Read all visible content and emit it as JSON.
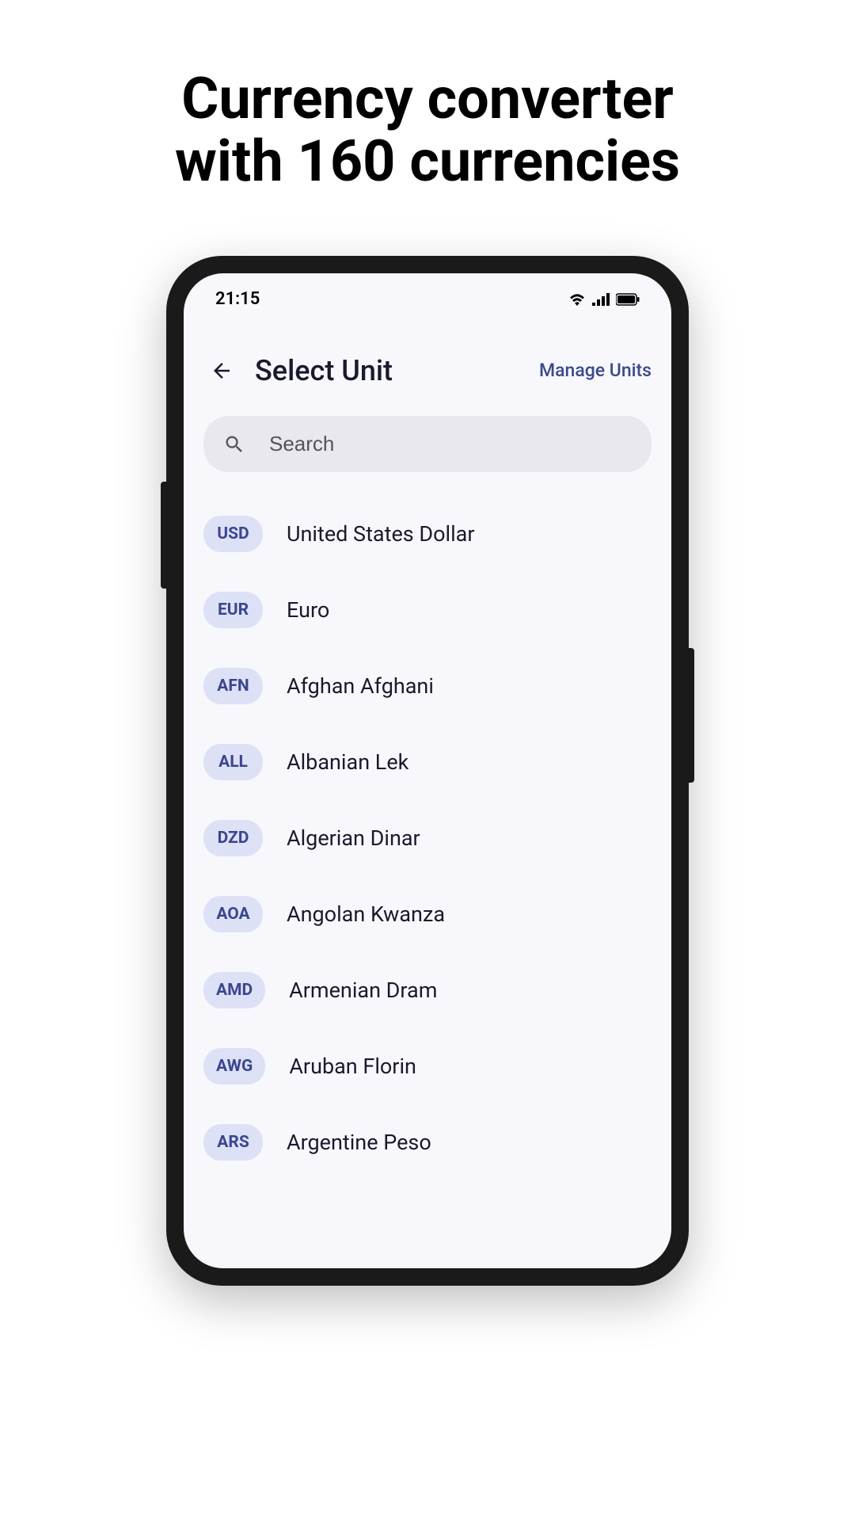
{
  "headline": {
    "line1": "Currency converter",
    "line2": "with 160 currencies"
  },
  "statusBar": {
    "time": "21:15"
  },
  "header": {
    "title": "Select Unit",
    "manageLabel": "Manage Units"
  },
  "search": {
    "placeholder": "Search"
  },
  "currencies": [
    {
      "code": "USD",
      "name": "United States Dollar"
    },
    {
      "code": "EUR",
      "name": "Euro"
    },
    {
      "code": "AFN",
      "name": "Afghan Afghani"
    },
    {
      "code": "ALL",
      "name": "Albanian Lek"
    },
    {
      "code": "DZD",
      "name": "Algerian Dinar"
    },
    {
      "code": "AOA",
      "name": "Angolan Kwanza"
    },
    {
      "code": "AMD",
      "name": "Armenian Dram"
    },
    {
      "code": "AWG",
      "name": "Aruban Florin"
    },
    {
      "code": "ARS",
      "name": "Argentine Peso"
    }
  ]
}
